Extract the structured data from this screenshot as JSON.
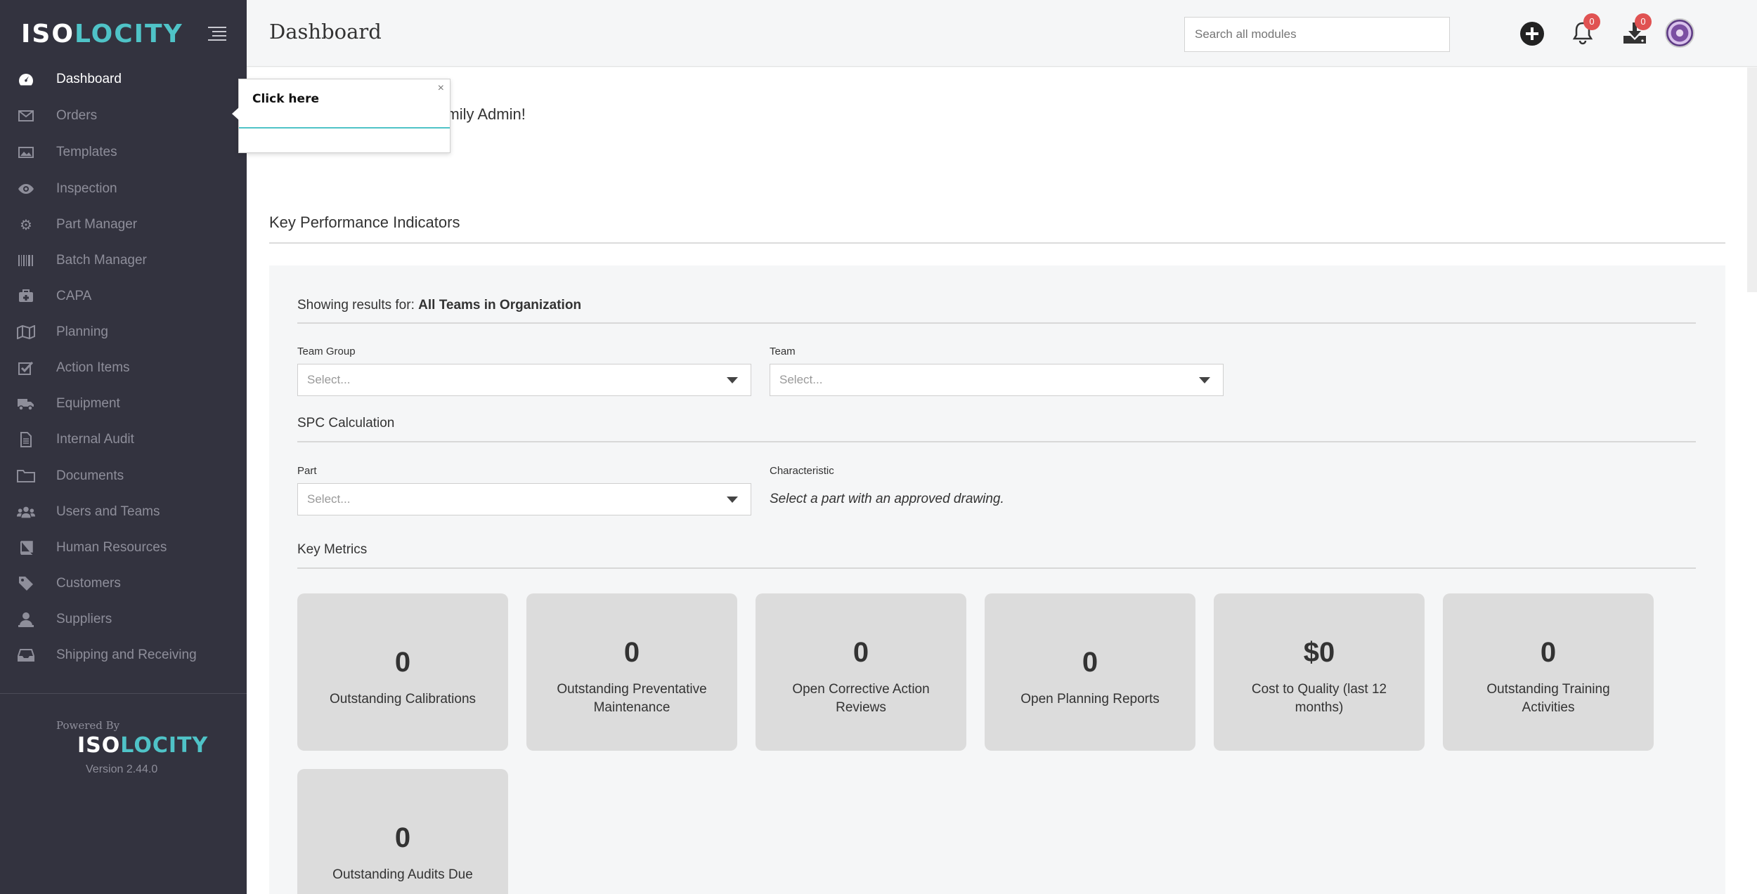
{
  "app": {
    "logo_iso": "ISO",
    "logo_locity": "LOCITY",
    "page_title": "Dashboard"
  },
  "header": {
    "search_placeholder": "Search all modules",
    "notifications_count": "0",
    "downloads_count": "0"
  },
  "sidebar": {
    "items": [
      {
        "label": "Dashboard",
        "icon": "dashboard-icon"
      },
      {
        "label": "Orders",
        "icon": "inbox-icon"
      },
      {
        "label": "Templates",
        "icon": "image-icon"
      },
      {
        "label": "Inspection",
        "icon": "eye-icon"
      },
      {
        "label": "Part Manager",
        "icon": "gear-icon"
      },
      {
        "label": "Batch Manager",
        "icon": "barcode-icon"
      },
      {
        "label": "CAPA",
        "icon": "first-aid-icon"
      },
      {
        "label": "Planning",
        "icon": "map-icon"
      },
      {
        "label": "Action Items",
        "icon": "checkbox-icon"
      },
      {
        "label": "Equipment",
        "icon": "truck-icon"
      },
      {
        "label": "Internal Audit",
        "icon": "file-icon"
      },
      {
        "label": "Documents",
        "icon": "folder-icon"
      },
      {
        "label": "Users and Teams",
        "icon": "users-icon"
      },
      {
        "label": "Human Resources",
        "icon": "book-icon"
      },
      {
        "label": "Customers",
        "icon": "tag-icon"
      },
      {
        "label": "Suppliers",
        "icon": "supplier-icon"
      },
      {
        "label": "Shipping and Receiving",
        "icon": "tray-icon"
      }
    ],
    "powered_by": "Powered By",
    "version": "Version 2.44.0"
  },
  "tooltip": {
    "text": "Click here",
    "close": "×"
  },
  "main": {
    "welcome_visible": "ty, Emily Admin!",
    "kpi_title": "Key Performance Indicators",
    "showing_prefix": "Showing results for:",
    "showing_value": "All Teams in Organization",
    "team_group_label": "Team Group",
    "team_group_value": "Select...",
    "team_label": "Team",
    "team_value": "Select...",
    "spc_title": "SPC Calculation",
    "part_label": "Part",
    "part_value": "Select...",
    "characteristic_label": "Characteristic",
    "characteristic_hint": "Select a part with an approved drawing.",
    "key_metrics_title": "Key Metrics",
    "metrics": [
      {
        "value": "0",
        "label": "Outstanding Calibrations"
      },
      {
        "value": "0",
        "label": "Outstanding Preventative Maintenance"
      },
      {
        "value": "0",
        "label": "Open Corrective Action Reviews"
      },
      {
        "value": "0",
        "label": "Open Planning Reports"
      },
      {
        "value": "$0",
        "label": "Cost to Quality (last 12 months)"
      },
      {
        "value": "0",
        "label": "Outstanding Training Activities"
      },
      {
        "value": "0",
        "label": "Outstanding Audits Due"
      }
    ]
  },
  "colors": {
    "sidebar_bg": "#33333f",
    "accent": "#4fc3c7",
    "badge": "#e05252",
    "card_bg": "#dcdcdc"
  }
}
